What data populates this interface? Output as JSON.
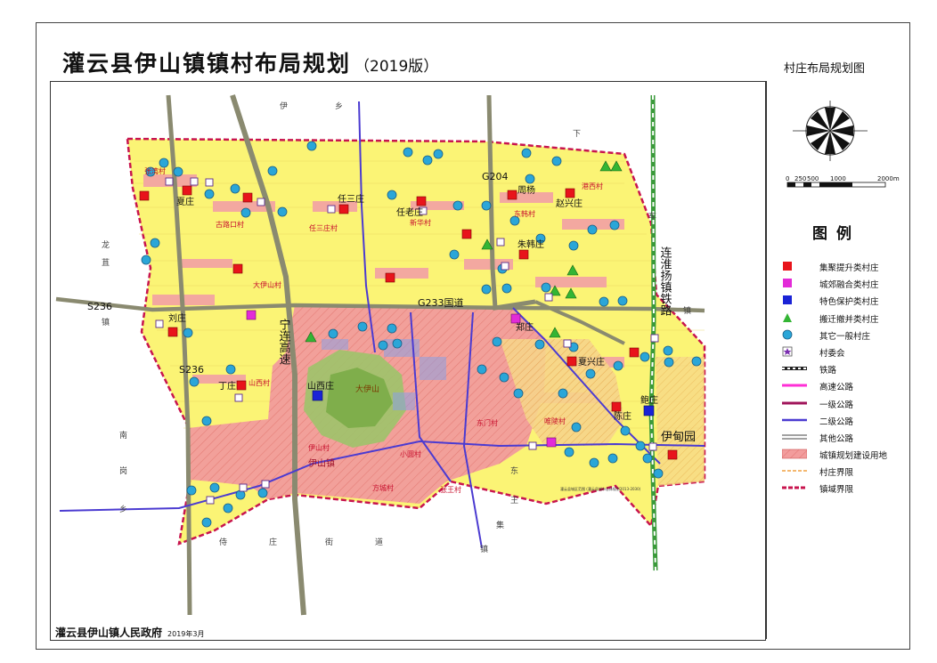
{
  "title": "灌云县伊山镇镇村布局规划",
  "edition": "（2019版）",
  "subtitle": "村庄布局规划图",
  "legend_title": "图例",
  "legend": [
    {
      "label": "集聚提升类村庄",
      "icon": "red-square-icon",
      "color": "#e8141b"
    },
    {
      "label": "城郊融合类村庄",
      "icon": "magenta-square-icon",
      "color": "#e32bd8"
    },
    {
      "label": "特色保护类村庄",
      "icon": "blue-square-icon",
      "color": "#1a23d6"
    },
    {
      "label": "搬迁撤并类村庄",
      "icon": "green-triangle-icon",
      "color": "#33b534"
    },
    {
      "label": "其它一般村庄",
      "icon": "cyan-circle-icon",
      "color": "#2aa6d8"
    },
    {
      "label": "村委会",
      "icon": "village-committee-icon",
      "color": "#7b2fb0"
    },
    {
      "label": "铁路",
      "icon": "railway-icon",
      "color": "#222222"
    },
    {
      "label": "高速公路",
      "icon": "expressway-icon",
      "color": "#ff2fd6"
    },
    {
      "label": "一级公路",
      "icon": "class1-road-icon",
      "color": "#a0145a"
    },
    {
      "label": "二级公路",
      "icon": "class2-road-icon",
      "color": "#4b3bd1"
    },
    {
      "label": "其他公路",
      "icon": "other-road-icon",
      "color": "#444444"
    },
    {
      "label": "城镇规划建设用地",
      "icon": "urban-land-hatch-icon",
      "color": "#e66a6a"
    },
    {
      "label": "村庄界限",
      "icon": "village-boundary-icon",
      "color": "#f0a040"
    },
    {
      "label": "镇域界限",
      "icon": "town-boundary-icon",
      "color": "#c8144e"
    }
  ],
  "scale": {
    "labels": [
      "0",
      "250",
      "500",
      "1000",
      "2000m"
    ]
  },
  "footer": {
    "org": "灌云县伊山镇人民政府",
    "date": "2019年3月"
  },
  "map": {
    "roads": {
      "s236_west": "S236",
      "s236_south": "S236",
      "g233": "G233国道",
      "g204": "G204",
      "expressway": "宁连高速",
      "railway": "连淮扬镇铁路"
    },
    "place_names": {
      "yidian": "伊甸园",
      "daishan": "大伊山",
      "yishan_town": "伊山镇"
    },
    "neighbors": [
      "伊",
      "乡",
      "下",
      "车",
      "龙",
      "苴",
      "镇",
      "南",
      "岗",
      "乡",
      "侍",
      "庄",
      "街",
      "道",
      "东",
      "王",
      "集",
      "镇",
      "镇"
    ],
    "red_villages": [
      "张湾村",
      "夏庄",
      "任三庄",
      "任老庄",
      "周杨",
      "赵兴庄",
      "朱韩庄",
      "刘庄",
      "丁庄",
      "夏兴庄",
      "陈庄"
    ],
    "magenta_villages": [
      "郑庄"
    ],
    "blue_villages": [
      "山西庄",
      "鲍庄"
    ],
    "village_labels": [
      "港西村",
      "古路口村",
      "任三庄村",
      "新华村",
      "东韩村",
      "大伊山村",
      "山西村",
      "伊山村",
      "小圆村",
      "东门村",
      "唯陵村",
      "方城村",
      "张王村"
    ],
    "note": "灌云县城区范围 (灌云县城市总体规划2013-2030)"
  }
}
